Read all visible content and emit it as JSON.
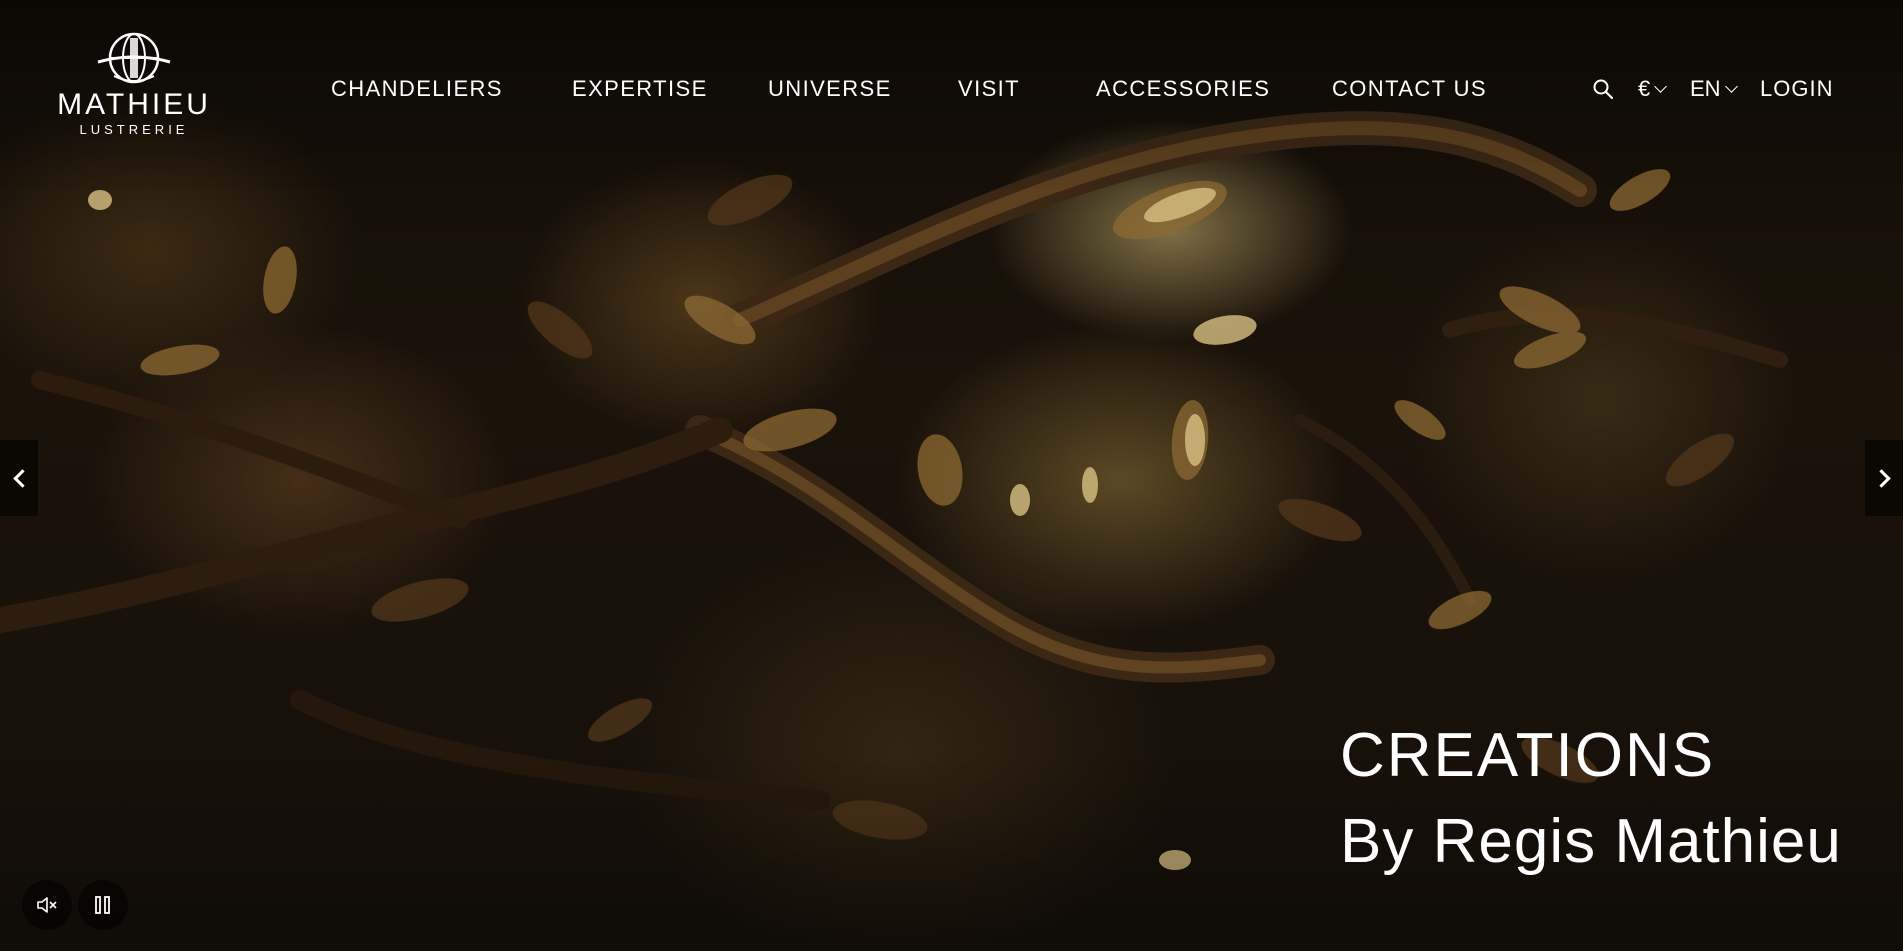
{
  "brand": {
    "name": "MATHIEU",
    "subtitle": "LUSTRERIE",
    "logo_icon": "globe-chandelier-icon"
  },
  "nav": {
    "items": [
      {
        "label": "CHANDELIERS"
      },
      {
        "label": "EXPERTISE"
      },
      {
        "label": "UNIVERSE"
      },
      {
        "label": "VISIT"
      },
      {
        "label": "ACCESSORIES"
      },
      {
        "label": "CONTACT US"
      }
    ]
  },
  "tools": {
    "search_icon": "search-icon",
    "currency": "€",
    "language": "EN",
    "login": "LOGIN"
  },
  "hero": {
    "title": "CREATIONS",
    "subtitle": "By Regis Mathieu",
    "prev_icon": "chevron-left-icon",
    "next_icon": "chevron-right-icon"
  },
  "video_controls": {
    "mute_icon": "speaker-muted-icon",
    "pause_icon": "pause-icon"
  },
  "colors": {
    "text": "#ffffff",
    "background": "#120d07",
    "gold": "#c9a85a"
  }
}
